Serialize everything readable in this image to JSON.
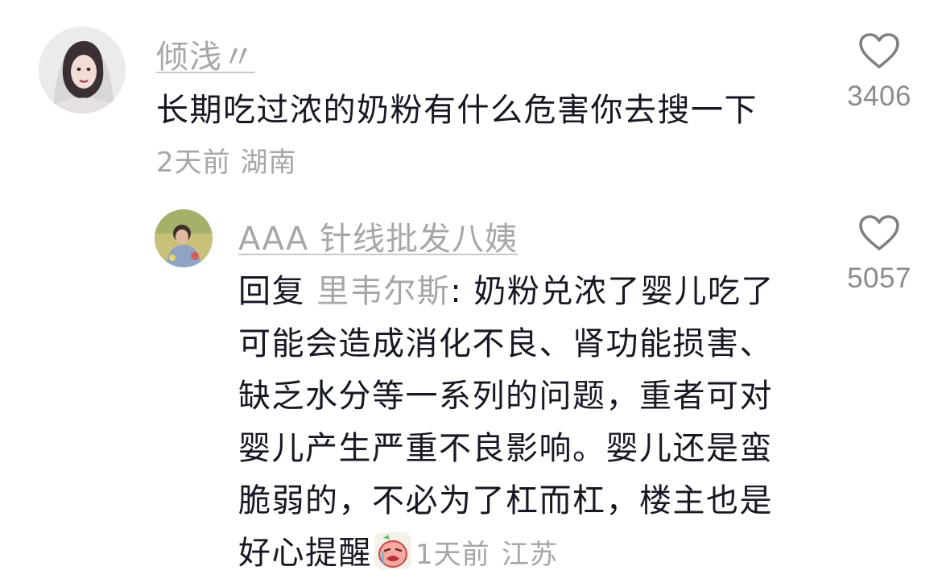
{
  "comments": [
    {
      "username": "倾浅〃",
      "text": "长期吃过浓的奶粉有什么危害你去搜一下",
      "time": "2天前",
      "location": "湖南",
      "likes": "3406"
    }
  ],
  "reply": {
    "username": "AAA 针线批发八姨",
    "prefix": "回复",
    "target": "里韦尔斯",
    "text": ": 奶粉兑浓了婴儿吃了可能会造成消化不良、肾功能损害、缺乏水分等一系列的问题，重者可对婴儿产生严重不良影响。婴儿还是蛮脆弱的，不必为了杠而杠，楼主也是好心提醒",
    "emoji": "crying-face-emoji",
    "time": "1天前",
    "location": "江苏",
    "likes": "5057"
  },
  "colors": {
    "text_primary": "#161823",
    "text_secondary": "#a7a7ab",
    "like_count": "#8a8a8f",
    "background": "#ffffff"
  },
  "icons": {
    "like": "heart-outline-icon"
  }
}
